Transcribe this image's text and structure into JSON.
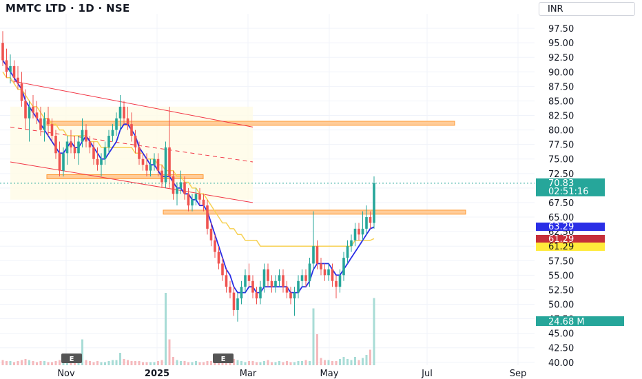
{
  "header": {
    "title": "MMTC LTD · 1D · NSE",
    "currency": "INR"
  },
  "chart_data": {
    "type": "candlestick",
    "symbol": "MMTC LTD",
    "interval": "1D",
    "exchange": "NSE",
    "y_ticks": [
      40.0,
      42.5,
      45.0,
      47.5,
      50.0,
      52.5,
      55.0,
      57.5,
      60.0,
      62.5,
      65.0,
      67.5,
      70.0,
      72.5,
      75.0,
      77.5,
      80.0,
      82.5,
      85.0,
      87.5,
      90.0,
      92.5,
      95.0,
      97.5
    ],
    "y_tick_labels": [
      "40.00",
      "42.50",
      "45.00",
      "47.50",
      "50.00",
      "52.50",
      "55.00",
      "57.50",
      "60.00",
      "62.50",
      "65.00",
      "67.50",
      "70.00",
      "72.50",
      "75.00",
      "77.50",
      "80.00",
      "82.50",
      "85.00",
      "87.50",
      "90.00",
      "92.50",
      "95.00",
      "97.50"
    ],
    "ylim": [
      39.5,
      100
    ],
    "x_tick_labels": [
      {
        "label": "Nov",
        "bold": false
      },
      {
        "label": "2025",
        "bold": true
      },
      {
        "label": "Mar",
        "bold": false
      },
      {
        "label": "May",
        "bold": false
      },
      {
        "label": "Jul",
        "bold": false
      },
      {
        "label": "Sep",
        "bold": false
      }
    ],
    "price_tags": [
      {
        "value": 70.83,
        "label": "70.83",
        "sublabel": "02:51:16",
        "color": "#26a69a",
        "name": "last-price"
      },
      {
        "value": 63.29,
        "label": "63.29",
        "color": "#2a2ee6",
        "name": "ma-fast"
      },
      {
        "value": 61.29,
        "label": "61.29",
        "color": "#c62f3a",
        "name": "ma-slow"
      },
      {
        "value": 61.29,
        "label": "61.29",
        "color": "#ffeb3b",
        "text_color": "#131722",
        "name": "ma-yellow"
      }
    ],
    "volume_tag": {
      "label": "24.68 M",
      "color": "#26a69a"
    },
    "last_price": 70.83,
    "ohlc": [
      [
        95,
        97,
        91,
        92
      ],
      [
        92,
        94,
        89,
        90
      ],
      [
        90,
        93,
        88,
        91
      ],
      [
        91,
        92,
        88,
        89
      ],
      [
        89,
        91,
        87,
        88
      ],
      [
        88,
        90,
        84,
        85
      ],
      [
        85,
        87,
        80,
        82
      ],
      [
        82,
        85,
        78,
        84
      ],
      [
        84,
        86,
        82,
        83
      ],
      [
        83,
        85,
        81,
        82
      ],
      [
        82,
        84,
        79,
        80
      ],
      [
        80,
        83,
        78,
        82
      ],
      [
        82,
        84,
        79,
        81
      ],
      [
        81,
        82,
        78,
        79
      ],
      [
        79,
        80,
        75,
        76
      ],
      [
        76,
        78,
        72,
        73
      ],
      [
        73,
        77,
        72,
        76
      ],
      [
        76,
        79,
        74,
        78
      ],
      [
        78,
        80,
        76,
        77
      ],
      [
        77,
        79,
        75,
        76
      ],
      [
        76,
        79,
        74,
        78
      ],
      [
        78,
        82,
        77,
        80
      ],
      [
        80,
        81,
        77,
        78
      ],
      [
        78,
        79,
        76,
        77
      ],
      [
        77,
        78,
        74,
        75
      ],
      [
        75,
        77,
        73,
        74
      ],
      [
        74,
        76,
        72,
        75
      ],
      [
        75,
        78,
        74,
        77
      ],
      [
        77,
        80,
        76,
        79
      ],
      [
        79,
        81,
        78,
        80
      ],
      [
        80,
        83,
        79,
        82
      ],
      [
        82,
        86,
        80,
        84
      ],
      [
        84,
        85,
        81,
        82
      ],
      [
        82,
        84,
        80,
        81
      ],
      [
        81,
        83,
        78,
        79
      ],
      [
        79,
        80,
        76,
        77
      ],
      [
        77,
        78,
        74,
        75
      ],
      [
        75,
        76,
        73,
        74
      ],
      [
        74,
        76,
        72,
        73
      ],
      [
        73,
        75,
        72,
        74
      ],
      [
        74,
        76,
        73,
        75
      ],
      [
        75,
        76,
        72,
        73
      ],
      [
        73,
        74,
        70,
        71
      ],
      [
        71,
        78,
        70,
        77
      ],
      [
        77,
        84,
        70,
        72
      ],
      [
        72,
        73,
        68,
        69
      ],
      [
        69,
        71,
        67,
        70
      ],
      [
        70,
        73,
        69,
        71
      ],
      [
        71,
        72,
        68,
        69
      ],
      [
        69,
        70,
        66,
        67
      ],
      [
        67,
        69,
        66,
        68
      ],
      [
        68,
        70,
        67,
        69
      ],
      [
        69,
        70,
        67,
        68
      ],
      [
        68,
        69,
        66,
        67
      ],
      [
        67,
        68,
        62,
        63
      ],
      [
        63,
        64,
        60,
        61
      ],
      [
        61,
        62,
        58,
        59
      ],
      [
        59,
        60,
        56,
        57
      ],
      [
        57,
        58,
        54,
        55
      ],
      [
        55,
        56,
        52,
        53
      ],
      [
        53,
        54,
        51,
        52
      ],
      [
        52,
        53,
        48,
        49
      ],
      [
        49,
        52,
        47,
        51
      ],
      [
        51,
        54,
        50,
        53
      ],
      [
        53,
        56,
        52,
        55
      ],
      [
        55,
        57,
        53,
        54
      ],
      [
        54,
        55,
        51,
        52
      ],
      [
        52,
        53,
        50,
        51
      ],
      [
        51,
        54,
        50,
        53
      ],
      [
        53,
        57,
        52,
        56
      ],
      [
        56,
        57,
        53,
        54
      ],
      [
        54,
        55,
        52,
        53
      ],
      [
        53,
        55,
        52,
        54
      ],
      [
        54,
        56,
        53,
        55
      ],
      [
        55,
        56,
        52,
        53
      ],
      [
        53,
        54,
        51,
        52
      ],
      [
        52,
        53,
        50,
        51
      ],
      [
        51,
        53,
        48,
        52
      ],
      [
        52,
        55,
        51,
        54
      ],
      [
        54,
        56,
        53,
        55
      ],
      [
        55,
        56,
        53,
        54
      ],
      [
        54,
        58,
        53,
        57
      ],
      [
        57,
        66,
        56,
        60
      ],
      [
        60,
        61,
        56,
        57
      ],
      [
        57,
        58,
        55,
        56
      ],
      [
        56,
        57,
        54,
        55
      ],
      [
        55,
        57,
        54,
        56
      ],
      [
        56,
        57,
        53,
        54
      ],
      [
        54,
        55,
        51,
        53
      ],
      [
        53,
        56,
        52,
        55
      ],
      [
        55,
        59,
        54,
        58
      ],
      [
        58,
        61,
        57,
        60
      ],
      [
        60,
        62,
        59,
        61
      ],
      [
        61,
        64,
        60,
        63
      ],
      [
        63,
        64,
        61,
        62
      ],
      [
        62,
        66,
        61,
        63
      ],
      [
        63,
        67,
        62,
        65
      ],
      [
        65,
        66,
        63,
        64
      ],
      [
        64,
        72,
        63,
        70.83
      ]
    ],
    "ma_fast": [
      92,
      91,
      90,
      89,
      88,
      87,
      85,
      84,
      83,
      82,
      81,
      80,
      79,
      78,
      77,
      76,
      76,
      77,
      78,
      77,
      77,
      78,
      79,
      78,
      77,
      76,
      75,
      75,
      76,
      77,
      78,
      80,
      81,
      81,
      80,
      79,
      77,
      76,
      75,
      74,
      74,
      73,
      72,
      72,
      72,
      71,
      70,
      70,
      69,
      69,
      68,
      68,
      67,
      67,
      66,
      64,
      62,
      60,
      58,
      56,
      55,
      53,
      52,
      52,
      52,
      53,
      53,
      52,
      52,
      53,
      53,
      53,
      53,
      53,
      53,
      53,
      52,
      52,
      52,
      53,
      53,
      54,
      56,
      57,
      57,
      57,
      57,
      56,
      55,
      55,
      56,
      57,
      58,
      59,
      60,
      61,
      62,
      63,
      63.29
    ],
    "ma_slow": [
      90,
      89,
      89,
      88,
      87,
      87,
      86,
      85,
      84,
      84,
      83,
      82,
      82,
      81,
      81,
      80,
      80,
      79,
      79,
      79,
      79,
      79,
      79,
      78,
      78,
      78,
      77,
      77,
      77,
      77,
      77,
      77,
      77,
      77,
      77,
      76,
      76,
      76,
      75,
      75,
      75,
      74,
      74,
      73,
      73,
      73,
      72,
      72,
      71,
      71,
      70,
      70,
      69,
      69,
      68,
      67,
      66,
      65,
      64,
      64,
      63,
      63,
      62,
      62,
      61,
      61,
      61,
      61,
      60,
      60,
      60,
      60,
      60,
      60,
      60,
      60,
      60,
      60,
      60,
      60,
      60,
      60,
      60,
      60,
      60,
      60,
      60,
      60,
      60,
      60,
      60,
      60,
      60,
      61,
      61,
      61,
      61,
      61,
      61.29
    ],
    "volume_relative": [
      0.05,
      0.04,
      0.04,
      0.03,
      0.04,
      0.05,
      0.06,
      0.05,
      0.04,
      0.03,
      0.04,
      0.04,
      0.03,
      0.03,
      0.04,
      0.05,
      0.04,
      0.05,
      0.04,
      0.03,
      0.04,
      0.25,
      0.05,
      0.04,
      0.03,
      0.04,
      0.03,
      0.03,
      0.04,
      0.05,
      0.05,
      0.12,
      0.06,
      0.05,
      0.04,
      0.04,
      0.04,
      0.03,
      0.03,
      0.03,
      0.03,
      0.04,
      0.05,
      0.7,
      0.25,
      0.08,
      0.05,
      0.04,
      0.04,
      0.03,
      0.03,
      0.04,
      0.03,
      0.03,
      0.04,
      0.04,
      0.04,
      0.03,
      0.03,
      0.04,
      0.04,
      0.06,
      0.05,
      0.04,
      0.03,
      0.04,
      0.04,
      0.03,
      0.03,
      0.04,
      0.05,
      0.03,
      0.03,
      0.04,
      0.03,
      0.04,
      0.03,
      0.03,
      0.04,
      0.04,
      0.05,
      0.04,
      0.55,
      0.3,
      0.07,
      0.05,
      0.05,
      0.04,
      0.04,
      0.06,
      0.08,
      0.06,
      0.05,
      0.08,
      0.05,
      0.07,
      0.1,
      0.15,
      0.65
    ]
  }
}
